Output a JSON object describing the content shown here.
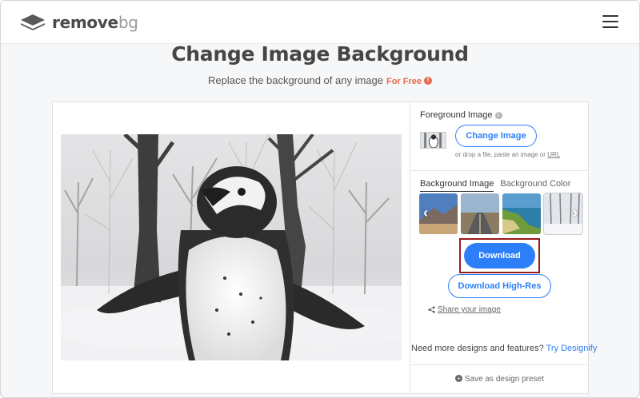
{
  "header": {
    "logo_main": "remove",
    "logo_light": "bg"
  },
  "hero": {
    "title": "Change Image Background",
    "subtitle": "Replace the background of any image",
    "free_badge": "For Free"
  },
  "foreground": {
    "title": "Foreground Image",
    "change_label": "Change Image",
    "drop_hint": "or drop a file, paste an image or",
    "url_label": "URL"
  },
  "background": {
    "tabs": [
      {
        "label": "Background Image",
        "active": true
      },
      {
        "label": "Background Color",
        "active": false
      }
    ],
    "thumbnails": [
      "mountain-desert",
      "desert-road",
      "coast-cliffs",
      "snowy-forest"
    ]
  },
  "actions": {
    "download_label": "Download",
    "hires_label": "Download High-Res",
    "share_label": "Share your image",
    "designify_text": "Need more designs and features?",
    "designify_link": "Try Designify",
    "preset_label": "Save as design preset"
  },
  "colors": {
    "accent": "#2d7ff9",
    "free_badge": "#e8694b",
    "highlight_box": "#9b1b1b"
  }
}
